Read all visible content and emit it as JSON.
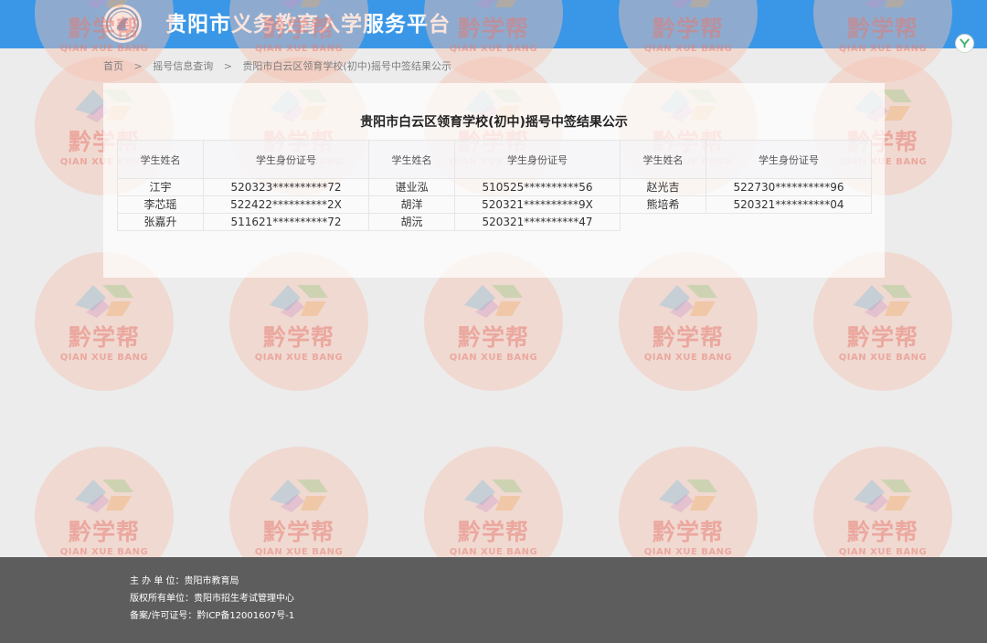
{
  "header": {
    "title": "贵阳市义务教育入学服务平台",
    "logo_icon": "school-emblem-icon",
    "brand_color": "#3a97e7"
  },
  "watermark": {
    "text": "黔学帮",
    "subtext": "QIAN XUE BANG"
  },
  "breadcrumb": {
    "items": [
      "首页",
      "摇号信息查询",
      "贵阳市白云区领育学校(初中)摇号中签结果公示"
    ],
    "separator": ">"
  },
  "panel": {
    "title": "贵阳市白云区领育学校(初中)摇号中签结果公示"
  },
  "table": {
    "headers": [
      "学生姓名",
      "学生身份证号",
      "学生姓名",
      "学生身份证号",
      "学生姓名",
      "学生身份证号"
    ],
    "rows": [
      [
        "江宇",
        "520323**********72",
        "谌业泓",
        "510525**********56",
        "赵光吉",
        "522730**********96"
      ],
      [
        "李芯瑶",
        "522422**********2X",
        "胡洋",
        "520321**********9X",
        "熊培希",
        "520321**********04"
      ],
      [
        "张嘉升",
        "511621**********72",
        "胡沅",
        "520321**********47",
        "",
        ""
      ]
    ]
  },
  "footer": {
    "host": "主  办  单  位：贵阳市教育局",
    "copyright": "版权所有单位：贵阳市招生考试管理中心",
    "icp": "备案/许可证号：黔ICP备12001607号-1"
  }
}
